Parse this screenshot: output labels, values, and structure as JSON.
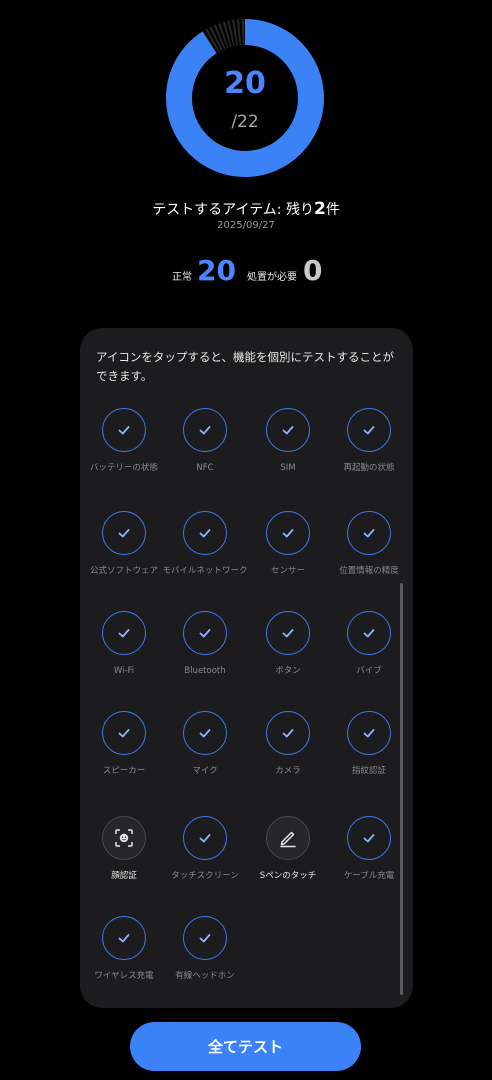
{
  "progress": {
    "count": "20",
    "total": "/22",
    "completed": 20,
    "of": 22
  },
  "summary": {
    "remaining_prefix": "テストするアイテム: 残り",
    "remaining_count": "2",
    "remaining_suffix": "件",
    "date": "2025/09/27"
  },
  "stats": {
    "normal_label": "正常",
    "normal_value": "20",
    "needs_action_label": "処置が必要",
    "needs_action_value": "0"
  },
  "panel": {
    "description": "アイコンをタップすると、機能を個別にテストすることができます。",
    "items": [
      {
        "label": "バッテリーの状態",
        "icon": "check-icon",
        "state": "passed"
      },
      {
        "label": "NFC",
        "icon": "check-icon",
        "state": "passed"
      },
      {
        "label": "SIM",
        "icon": "check-icon",
        "state": "passed"
      },
      {
        "label": "再起動の状態",
        "icon": "check-icon",
        "state": "passed"
      },
      {
        "label": "公式ソフトウェア",
        "icon": "check-icon",
        "state": "passed"
      },
      {
        "label": "モバイルネットワーク",
        "icon": "check-icon",
        "state": "passed"
      },
      {
        "label": "センサー",
        "icon": "check-icon",
        "state": "passed"
      },
      {
        "label": "位置情報の精度",
        "icon": "check-icon",
        "state": "passed"
      },
      {
        "label": "Wi-Fi",
        "icon": "check-icon",
        "state": "passed"
      },
      {
        "label": "Bluetooth",
        "icon": "check-icon",
        "state": "passed"
      },
      {
        "label": "ボタン",
        "icon": "check-icon",
        "state": "passed"
      },
      {
        "label": "バイブ",
        "icon": "check-icon",
        "state": "passed"
      },
      {
        "label": "スピーカー",
        "icon": "check-icon",
        "state": "passed"
      },
      {
        "label": "マイク",
        "icon": "check-icon",
        "state": "passed"
      },
      {
        "label": "カメラ",
        "icon": "check-icon",
        "state": "passed"
      },
      {
        "label": "指紋認証",
        "icon": "check-icon",
        "state": "passed"
      },
      {
        "label": "顔認証",
        "icon": "face-scan-icon",
        "state": "untested"
      },
      {
        "label": "タッチスクリーン",
        "icon": "check-icon",
        "state": "passed"
      },
      {
        "label": "Sペンのタッチ",
        "icon": "pen-icon",
        "state": "untested"
      },
      {
        "label": "ケーブル充電",
        "icon": "check-icon",
        "state": "passed"
      },
      {
        "label": "ワイヤレス充電",
        "icon": "check-icon",
        "state": "passed"
      },
      {
        "label": "有線ヘッドホン",
        "icon": "check-icon",
        "state": "passed"
      }
    ]
  },
  "actions": {
    "test_all_label": "全てテスト"
  },
  "colors": {
    "accent": "#3b82f6",
    "ring_remaining": "#2a2a2a",
    "panel_bg": "#1c1c1e"
  }
}
